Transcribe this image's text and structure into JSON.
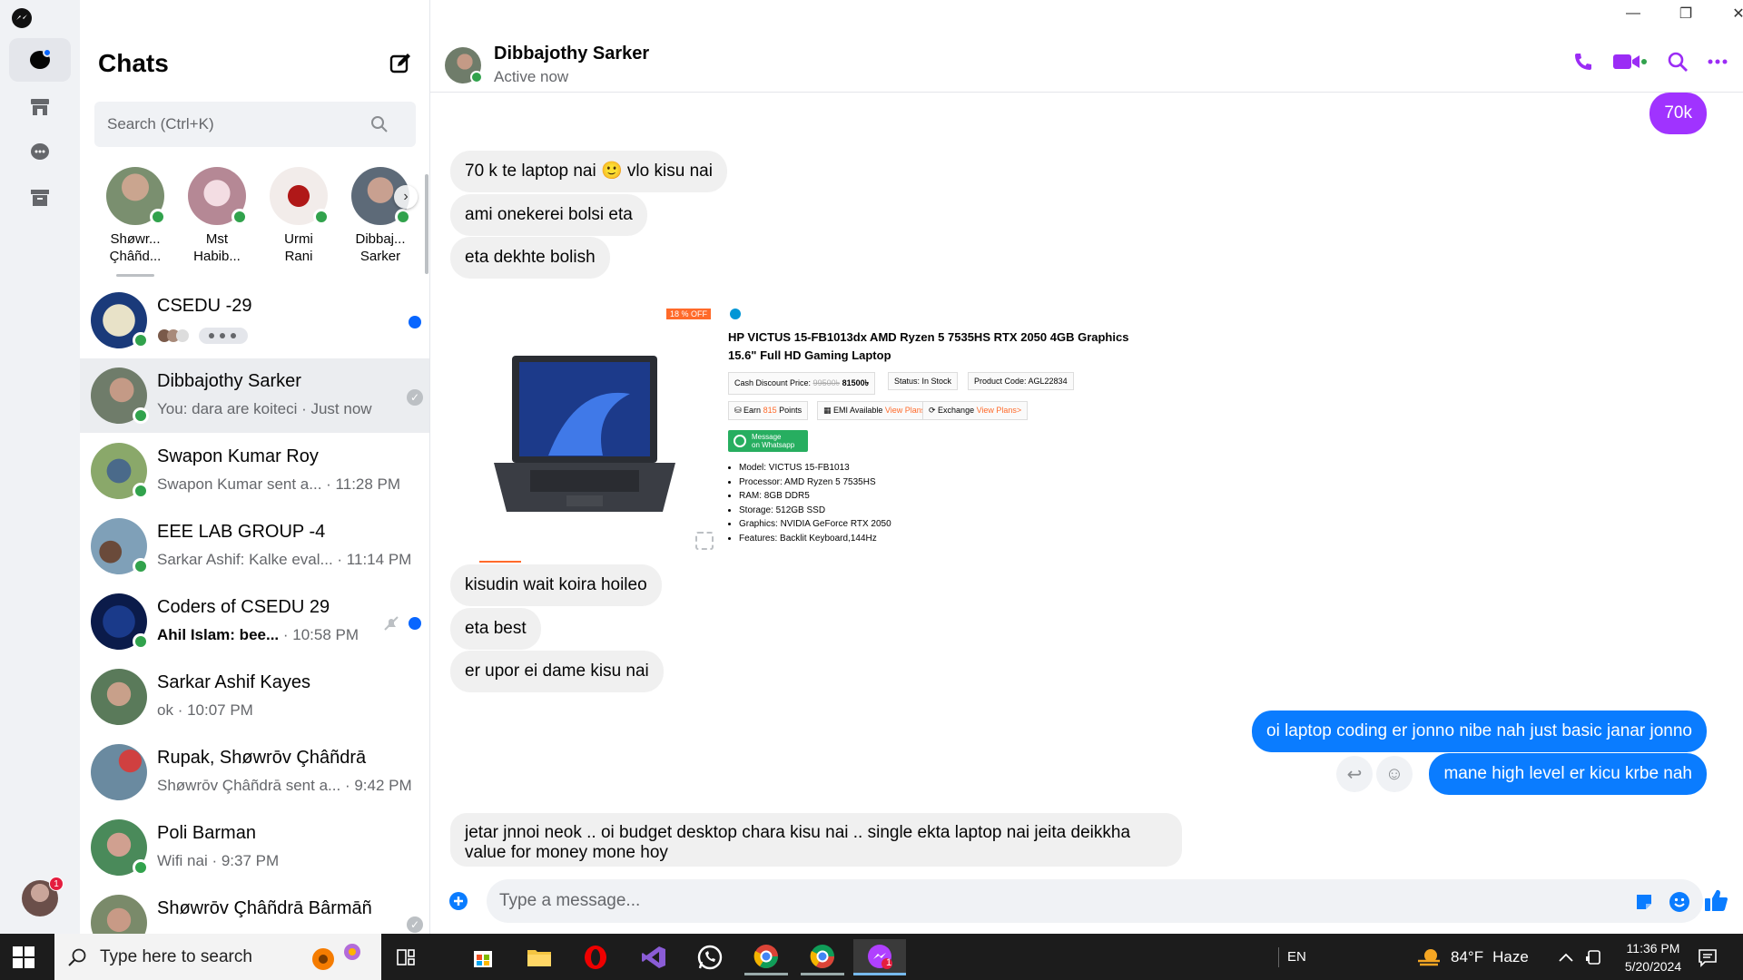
{
  "window": {
    "minimize": "—",
    "restore": "❐",
    "close": "✕"
  },
  "sidebar": {
    "badge_count": "1"
  },
  "list": {
    "title": "Chats",
    "search_placeholder": "Search (Ctrl+K)",
    "stories": [
      {
        "name1": "Shøwr...",
        "name2": "Çhâñd..."
      },
      {
        "name1": "Mst",
        "name2": "Habib..."
      },
      {
        "name1": "Urmi",
        "name2": "Rani"
      },
      {
        "name1": "Dibbaj...",
        "name2": "Sarker"
      }
    ],
    "conversations": [
      {
        "title": "CSEDU -29",
        "sub": "",
        "time": "",
        "unread": true
      },
      {
        "title": "Dibbajothy Sarker",
        "sub": "You: dara are koiteci · Just now",
        "time": "",
        "unread": false
      },
      {
        "title": "Swapon Kumar Roy",
        "sub": "Swapon Kumar sent a...",
        "time": " · 11:28 PM",
        "unread": false
      },
      {
        "title": "EEE LAB GROUP -4",
        "sub": "Sarkar Ashif: Kalke eval...",
        "time": " · 11:14 PM",
        "unread": false
      },
      {
        "title": "Coders of CSEDU 29",
        "sub_bold": "Ahil Islam: bee...",
        "time": " · 10:58 PM",
        "unread": true
      },
      {
        "title": "Sarkar Ashif Kayes",
        "sub": "ok",
        "time": " · 10:07 PM",
        "unread": false
      },
      {
        "title": "Rupak, Shøwrōv Çhâñdrā",
        "sub": "Shøwrōv Çhâñdrā sent a...",
        "time": " · 9:42 PM",
        "unread": false
      },
      {
        "title": "Poli Barman",
        "sub": "Wifi nai",
        "time": " · 9:37 PM",
        "unread": false
      },
      {
        "title": "Shøwrōv Çhâñdrā Bârmāñ",
        "sub": "",
        "time": "",
        "unread": false
      }
    ]
  },
  "chat": {
    "name": "Dibbajothy Sarker",
    "status": "Active now",
    "messages": {
      "m0": "70k",
      "m1": "70 k te laptop nai 🙂 vlo kisu nai",
      "m2": "ami onekerei bolsi eta",
      "m3": "eta dekhte bolish",
      "m4": "kisudin wait koira hoileo",
      "m5": "eta best",
      "m6": "er upor ei dame kisu nai",
      "m7": "oi laptop coding er jonno nibe nah just basic janar jonno",
      "m8": "mane high level er kicu krbe nah",
      "m9a": "jetar jnnoi neok .. oi  budget desktop chara kisu nai .. single ekta laptop nai jeita deikkha",
      "m9b": "value for money mone hoy"
    },
    "product": {
      "discount": "18 % OFF",
      "title1": "HP VICTUS 15-FB1013dx AMD Ryzen 5 7535HS RTX 2050 4GB Graphics",
      "title2": "15.6\" Full HD Gaming Laptop",
      "cash_label": "Cash Discount Price:",
      "old_price": "99500৳",
      "price": "81500৳",
      "status": "Status: In Stock",
      "code": "Product Code: AGL22834",
      "earn_pre": "Earn ",
      "earn_num": "815",
      "earn_post": " Points",
      "emi": "EMI Available ",
      "emi_link": "View Plans>",
      "exchange": "Exchange ",
      "exchange_link": "View Plans>",
      "wa1": "Message",
      "wa2": "on Whatsapp",
      "specs": [
        "Model: VICTUS 15-FB1013",
        "Processor: AMD Ryzen 5 7535HS",
        "RAM: 8GB DDR5",
        "Storage: 512GB SSD",
        "Graphics: NVIDIA GeForce RTX 2050",
        "Features: Backlit Keyboard,144Hz"
      ]
    },
    "composer_placeholder": "Type a message..."
  },
  "taskbar": {
    "search_text": "Type here to search",
    "lang": "EN",
    "temp": "84°F",
    "weather": "Haze",
    "time": "11:36 PM",
    "date": "5/20/2024",
    "notif_badge": "1"
  },
  "colors": {
    "accent": "#0a7cff",
    "purple": "#a033ff",
    "online": "#31a24c",
    "messenger_icons": "#9b2cf5"
  }
}
